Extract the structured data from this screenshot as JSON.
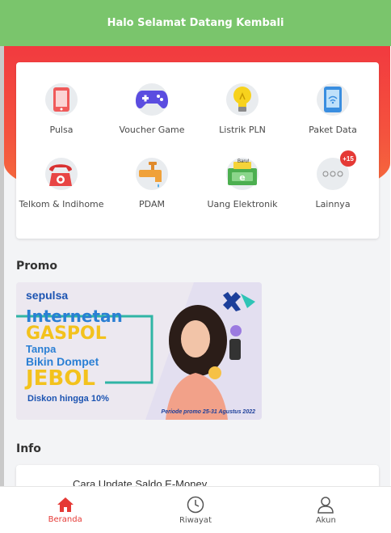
{
  "header": {
    "title": "Halo Selamat Datang Kembali"
  },
  "services": [
    {
      "label": "Pulsa",
      "icon": "phone-icon"
    },
    {
      "label": "Voucher Game",
      "icon": "gamepad-icon"
    },
    {
      "label": "Listrik PLN",
      "icon": "lightbulb-icon"
    },
    {
      "label": "Paket Data",
      "icon": "data-phone-icon"
    },
    {
      "label": "Telkom & Indihome",
      "icon": "telephone-icon"
    },
    {
      "label": "PDAM",
      "icon": "water-tap-icon"
    },
    {
      "label": "Uang Elektronik",
      "icon": "e-money-icon",
      "tag": "Baru!"
    },
    {
      "label": "Lainnya",
      "icon": "more-icon",
      "badge": "+15"
    }
  ],
  "promo": {
    "title": "Promo",
    "banner": {
      "brand": "sepulsa",
      "line1": "Internetan",
      "line2": "GASPOL",
      "line3": "Tanpa",
      "line4": "Bikin Dompet",
      "line5": "JEBOL",
      "discount": "Diskon hingga 10%",
      "period": "Periode promo 25-31 Agustus 2022"
    }
  },
  "info": {
    "title": "Info",
    "items": [
      {
        "title": "Cara Update Saldo E-Money"
      }
    ]
  },
  "nav": [
    {
      "label": "Beranda",
      "icon": "home-icon",
      "active": true
    },
    {
      "label": "Riwayat",
      "icon": "clock-icon",
      "active": false
    },
    {
      "label": "Akun",
      "icon": "user-icon",
      "active": false
    }
  ],
  "colors": {
    "header": "#7ac56c",
    "hero": "#f23a3f",
    "active_nav": "#e53935",
    "inactive_nav": "#555555"
  }
}
